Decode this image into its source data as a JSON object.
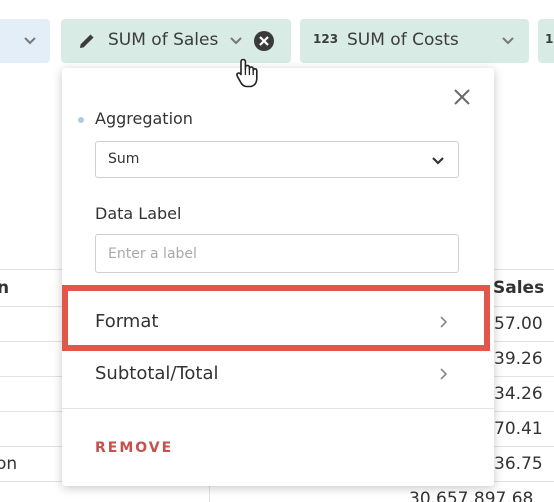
{
  "pills": {
    "sales": {
      "label": "SUM of Sales"
    },
    "costs": {
      "label": "SUM of Costs",
      "type_icon": "123"
    },
    "partial": {
      "type_icon": "1"
    }
  },
  "table": {
    "headers": {
      "left": "n",
      "right": "Sales"
    },
    "left_cells": [
      "on"
    ],
    "right_cells": [
      "57.00",
      "39.26",
      "34.26",
      "70.41",
      "36.75",
      "30,657,897.68"
    ]
  },
  "popover": {
    "aggregation_label": "Aggregation",
    "aggregation_value": "Sum",
    "data_label_label": "Data Label",
    "data_label_placeholder": "Enter a label",
    "data_label_value": "",
    "menu": {
      "format": "Format",
      "subtotal": "Subtotal/Total"
    },
    "remove_label": "REMOVE"
  },
  "colors": {
    "pill_green": "#d8ebe4",
    "pill_blue": "#e3eef9",
    "highlight": "#e3574a",
    "remove": "#c8504a",
    "dot": "#aecbe3"
  },
  "icons": {
    "edit": "pencil-icon",
    "expand": "chevron-down-icon",
    "clear": "x-circle-icon",
    "close": "close-icon",
    "submenu": "chevron-right-icon",
    "pointer": "hand-cursor-icon"
  }
}
